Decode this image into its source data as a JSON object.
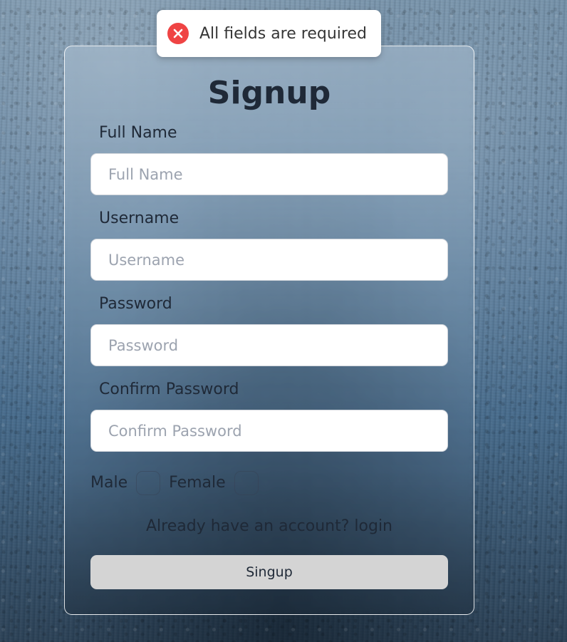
{
  "toast": {
    "icon": "error-circle-icon",
    "icon_color": "#ef4444",
    "message": "All fields are required"
  },
  "form": {
    "title": "Signup",
    "fields": [
      {
        "label": "Full Name",
        "placeholder": "Full Name",
        "value": ""
      },
      {
        "label": "Username",
        "placeholder": "Username",
        "value": ""
      },
      {
        "label": "Password",
        "placeholder": "Password",
        "value": ""
      },
      {
        "label": "Confirm Password",
        "placeholder": "Confirm Password",
        "value": ""
      }
    ],
    "gender": {
      "male_label": "Male",
      "male_checked": false,
      "female_label": "Female",
      "female_checked": false
    },
    "login_link": "Already have an account? login",
    "submit_label": "Singup"
  },
  "colors": {
    "title": "#1f2937",
    "button_bg": "#d4d4d4",
    "toast_error": "#ef4444"
  }
}
